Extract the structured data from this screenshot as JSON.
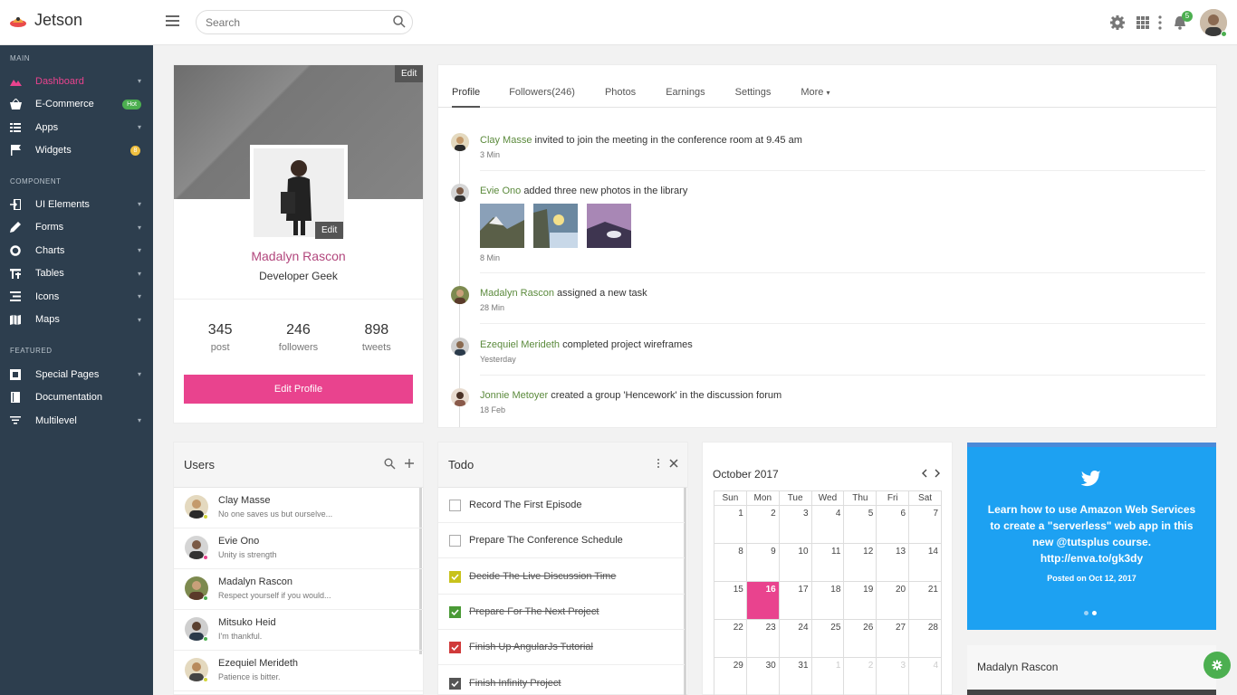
{
  "app": {
    "name": "Jetson"
  },
  "search": {
    "placeholder": "Search"
  },
  "topbar": {
    "notification_count": "5"
  },
  "sidebar": {
    "sections": [
      {
        "title": "MAIN",
        "items": [
          {
            "label": "Dashboard",
            "icon": "dashboard-icon",
            "active": true
          },
          {
            "label": "E-Commerce",
            "icon": "basket-icon",
            "badge": "Hot"
          },
          {
            "label": "Apps",
            "icon": "grid-icon"
          },
          {
            "label": "Widgets",
            "icon": "flag-icon",
            "badge": "8"
          }
        ]
      },
      {
        "title": "COMPONENT",
        "items": [
          {
            "label": "UI Elements",
            "icon": "login-icon"
          },
          {
            "label": "Forms",
            "icon": "pencil-icon"
          },
          {
            "label": "Charts",
            "icon": "donut-icon"
          },
          {
            "label": "Tables",
            "icon": "table-icon"
          },
          {
            "label": "Icons",
            "icon": "list-icon"
          },
          {
            "label": "Maps",
            "icon": "map-icon"
          }
        ]
      },
      {
        "title": "FEATURED",
        "items": [
          {
            "label": "Special Pages",
            "icon": "pages-icon"
          },
          {
            "label": "Documentation",
            "icon": "book-icon"
          },
          {
            "label": "Multilevel",
            "icon": "filter-icon"
          }
        ]
      }
    ]
  },
  "profile": {
    "cover_edit": "Edit",
    "photo_edit": "Edit",
    "name": "Madalyn Rascon",
    "role": "Developer Geek",
    "stats": [
      {
        "value": "345",
        "label": "post"
      },
      {
        "value": "246",
        "label": "followers"
      },
      {
        "value": "898",
        "label": "tweets"
      }
    ],
    "edit_button": "Edit Profile"
  },
  "feed": {
    "tabs": [
      "Profile",
      "Followers(246)",
      "Photos",
      "Earnings",
      "Settings",
      "More"
    ],
    "activities": [
      {
        "name": "Clay Masse",
        "text": "invited to join the meeting in the conference room at 9.45 am",
        "time": "3 Min"
      },
      {
        "name": "Evie Ono",
        "text": "added three new photos in the library",
        "time": "8 Min"
      },
      {
        "name": "Madalyn Rascon",
        "text": "assigned a new task",
        "time": "28 Min"
      },
      {
        "name": "Ezequiel Merideth",
        "text": "completed project wireframes",
        "time": "Yesterday"
      },
      {
        "name": "Jonnie Metoyer",
        "text": "created a group 'Hencework' in the discussion forum",
        "time": "18 Feb"
      }
    ]
  },
  "users": {
    "title": "Users",
    "list": [
      {
        "name": "Clay Masse",
        "message": "No one saves us but ourselve..."
      },
      {
        "name": "Evie Ono",
        "message": "Unity is strength"
      },
      {
        "name": "Madalyn Rascon",
        "message": "Respect yourself if you would..."
      },
      {
        "name": "Mitsuko Heid",
        "message": "I'm thankful."
      },
      {
        "name": "Ezequiel Merideth",
        "message": "Patience is bitter."
      }
    ]
  },
  "todo": {
    "title": "Todo",
    "items": [
      {
        "label": "Record The First Episode",
        "done": false,
        "color": ""
      },
      {
        "label": "Prepare The Conference Schedule",
        "done": false,
        "color": ""
      },
      {
        "label": "Decide The Live Discussion Time",
        "done": true,
        "color": "#c8c21c"
      },
      {
        "label": "Prepare For The Next Project",
        "done": true,
        "color": "#4a9a36"
      },
      {
        "label": "Finish Up AngularJs Tutorial",
        "done": true,
        "color": "#d03a3a"
      },
      {
        "label": "Finish Infinity Project",
        "done": true,
        "color": "#555555"
      }
    ]
  },
  "calendar": {
    "title": "October 2017",
    "weekdays": [
      "Sun",
      "Mon",
      "Tue",
      "Wed",
      "Thu",
      "Fri",
      "Sat"
    ],
    "today": "16",
    "weeks": [
      [
        "1",
        "2",
        "3",
        "4",
        "5",
        "6",
        "7"
      ],
      [
        "8",
        "9",
        "10",
        "11",
        "12",
        "13",
        "14"
      ],
      [
        "15",
        "16",
        "17",
        "18",
        "19",
        "20",
        "21"
      ],
      [
        "22",
        "23",
        "24",
        "25",
        "26",
        "27",
        "28"
      ],
      [
        "29",
        "30",
        "31",
        "1",
        "2",
        "3",
        "4"
      ]
    ]
  },
  "twitter": {
    "text": "Learn how to use Amazon Web Services to create a \"serverless\" web app in this new @tutsplus course. http://enva.to/gk3dy",
    "posted": "Posted on Oct 12, 2017"
  },
  "mini_profile": {
    "name": "Madalyn Rascon"
  },
  "colors": {
    "accent": "#e9438e",
    "sidebar": "#2d3e4e",
    "success": "#4caf50",
    "twitter": "#1da1f2"
  }
}
